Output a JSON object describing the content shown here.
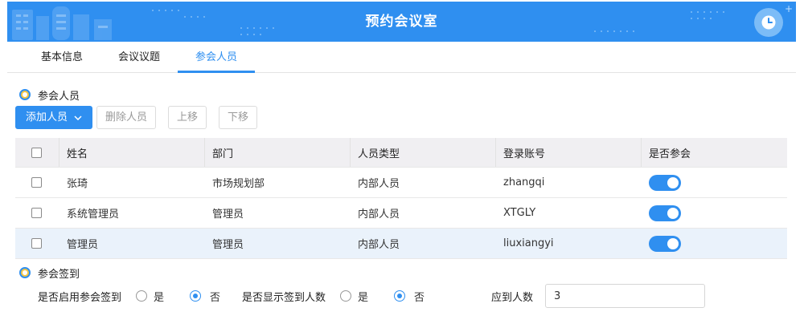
{
  "header": {
    "title": "预约会议室"
  },
  "tabs": [
    {
      "label": "基本信息"
    },
    {
      "label": "会议议题"
    },
    {
      "label": "参会人员"
    }
  ],
  "attendees_section": {
    "title": "参会人员"
  },
  "toolbar": {
    "add_label": "添加人员",
    "delete_label": "删除人员",
    "up_label": "上移",
    "down_label": "下移"
  },
  "table": {
    "columns": [
      "姓名",
      "部门",
      "人员类型",
      "登录账号",
      "是否参会"
    ],
    "rows": [
      {
        "name": "张琦",
        "dept": "市场规划部",
        "type": "内部人员",
        "account": "zhangqi",
        "attend": true
      },
      {
        "name": "系统管理员",
        "dept": "管理员",
        "type": "内部人员",
        "account": "XTGLY",
        "attend": true
      },
      {
        "name": "管理员",
        "dept": "管理员",
        "type": "内部人员",
        "account": "liuxiangyi",
        "attend": true
      }
    ]
  },
  "signin_section": {
    "title": "参会签到",
    "enable_label": "是否启用参会签到",
    "enable_yes": "是",
    "enable_no": "否",
    "enable_value": "否",
    "show_count_label": "是否显示签到人数",
    "show_yes": "是",
    "show_no": "否",
    "show_value": "否",
    "expected_label": "应到人数",
    "expected_value": "3"
  },
  "colors": {
    "accent": "#2f8ff0",
    "header_bg": "#2f8ff0",
    "row_highlight": "#eaf2fb"
  }
}
